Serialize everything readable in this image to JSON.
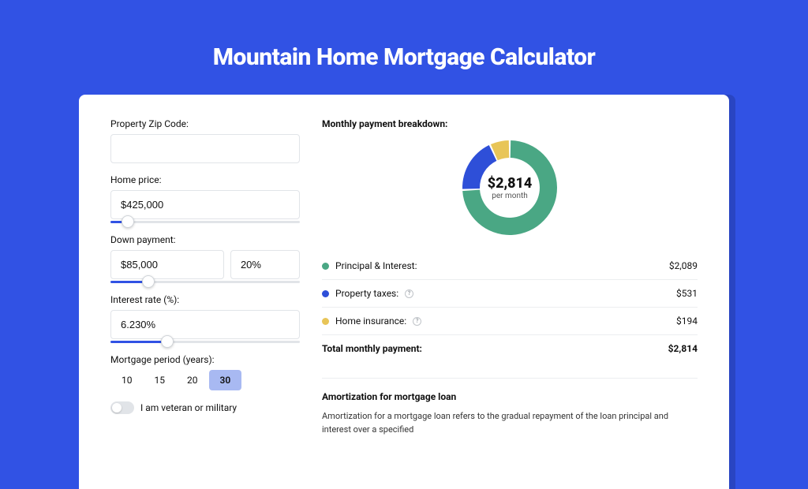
{
  "page_title": "Mountain Home Mortgage Calculator",
  "form": {
    "zip_label": "Property Zip Code:",
    "zip_value": "",
    "home_price_label": "Home price:",
    "home_price_value": "$425,000",
    "home_price_slider_pct": 9,
    "down_payment_label": "Down payment:",
    "down_payment_value": "$85,000",
    "down_payment_pct_value": "20%",
    "down_payment_slider_pct": 20,
    "interest_label": "Interest rate (%):",
    "interest_value": "6.230%",
    "interest_slider_pct": 30,
    "period_label": "Mortgage period (years):",
    "period_options": [
      "10",
      "15",
      "20",
      "30"
    ],
    "period_selected_index": 3,
    "veteran_label": "I am veteran or military",
    "veteran_on": false
  },
  "breakdown": {
    "title": "Monthly payment breakdown:",
    "center_amount": "$2,814",
    "center_period": "per month",
    "items": [
      {
        "label": "Principal & Interest:",
        "value": "$2,089",
        "color": "#4aa784",
        "has_info": false
      },
      {
        "label": "Property taxes:",
        "value": "$531",
        "color": "#2e4fd8",
        "has_info": true
      },
      {
        "label": "Home insurance:",
        "value": "$194",
        "color": "#e8c558",
        "has_info": true
      }
    ],
    "total_label": "Total monthly payment:",
    "total_value": "$2,814"
  },
  "amortization": {
    "title": "Amortization for mortgage loan",
    "text": "Amortization for a mortgage loan refers to the gradual repayment of the loan principal and interest over a specified"
  },
  "chart_data": {
    "type": "pie",
    "title": "Monthly payment breakdown",
    "series": [
      {
        "name": "Principal & Interest",
        "value": 2089,
        "color": "#4aa784"
      },
      {
        "name": "Property taxes",
        "value": 531,
        "color": "#2e4fd8"
      },
      {
        "name": "Home insurance",
        "value": 194,
        "color": "#e8c558"
      }
    ],
    "total": 2814,
    "center_label": "$2,814 per month"
  }
}
